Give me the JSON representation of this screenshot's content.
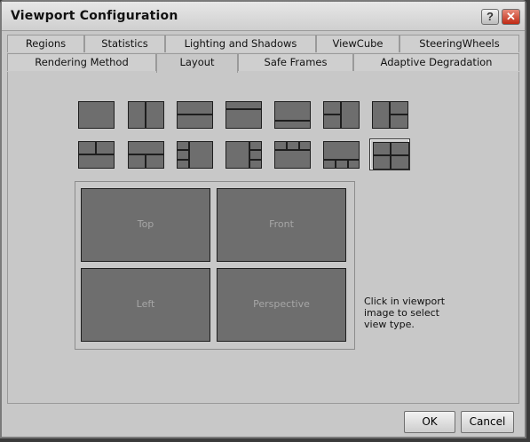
{
  "window": {
    "title": "Viewport Configuration",
    "help_label": "?",
    "close_label": "✕"
  },
  "tabs": {
    "row1": [
      "Regions",
      "Statistics",
      "Lighting and Shadows",
      "ViewCube",
      "SteeringWheels"
    ],
    "row2": [
      "Rendering Method",
      "Layout",
      "Safe Frames",
      "Adaptive Degradation"
    ],
    "active": "Layout"
  },
  "layouts": {
    "count": 14,
    "selected": "2x2 grid"
  },
  "preview": {
    "viewports": [
      "Top",
      "Front",
      "Left",
      "Perspective"
    ],
    "hint": "Click in viewport image to select view type."
  },
  "footer": {
    "ok_label": "OK",
    "cancel_label": "Cancel"
  }
}
